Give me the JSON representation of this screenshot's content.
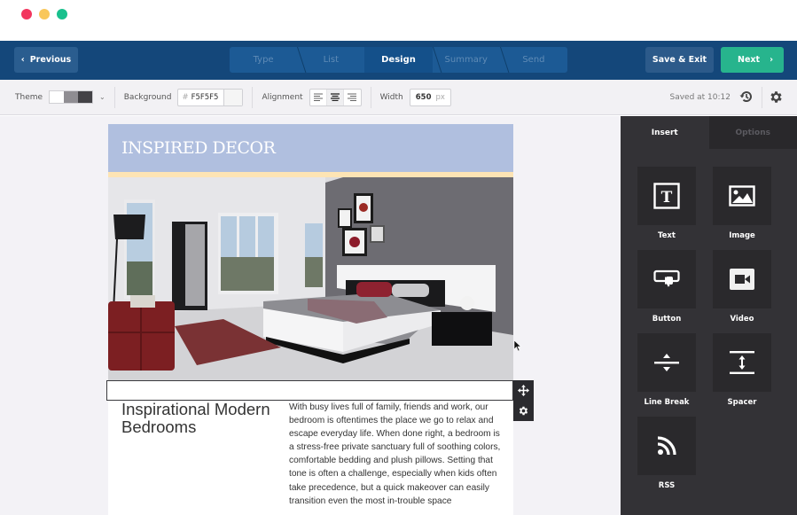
{
  "window": {
    "controls": [
      "close",
      "minimize",
      "maximize"
    ]
  },
  "topbar": {
    "previous_label": "Previous",
    "steps": [
      {
        "label": "Type",
        "active": false
      },
      {
        "label": "List",
        "active": false
      },
      {
        "label": "Design",
        "active": true
      },
      {
        "label": "Summary",
        "active": false
      },
      {
        "label": "Send",
        "active": false
      }
    ],
    "save_exit_label": "Save & Exit",
    "next_label": "Next"
  },
  "toolbar": {
    "theme_label": "Theme",
    "theme_swatches": [
      "#ffffff",
      "#8f8d92",
      "#434246"
    ],
    "background_label": "Background",
    "background_hash": "#",
    "background_value": "F5F5F5",
    "alignment_label": "Alignment",
    "alignment_options": [
      "left",
      "center",
      "right"
    ],
    "alignment_selected": "center",
    "width_label": "Width",
    "width_value": "650",
    "width_unit": "px",
    "saved_status": "Saved at 10:12"
  },
  "email": {
    "banner_title": "INSPIRED DECOR",
    "banner_color": "#b0bfdf",
    "stripe_color": "#fde4b4",
    "hero_image_alt": "Modern bedroom with white bed, grey wall, red ottoman and rug",
    "heading": "Inspirational Modern Bedrooms",
    "body": "With busy lives full of family, friends and work, our bedroom is oftentimes the place we go to relax and escape everyday life. When done right, a bedroom is a stress-free private sanctuary full of soothing colors, comfortable bedding and plush pillows. Setting that tone is often a challenge, especially when kids often take precedence, but a quick makeover can easily transition even the most in-trouble space"
  },
  "panel": {
    "tabs": [
      {
        "label": "Insert",
        "active": true
      },
      {
        "label": "Options",
        "active": false
      }
    ],
    "items": [
      {
        "label": "Text",
        "icon": "text-icon"
      },
      {
        "label": "Image",
        "icon": "image-icon"
      },
      {
        "label": "Button",
        "icon": "button-icon"
      },
      {
        "label": "Video",
        "icon": "video-icon"
      },
      {
        "label": "Line Break",
        "icon": "line-break-icon"
      },
      {
        "label": "Spacer",
        "icon": "spacer-icon"
      },
      {
        "label": "RSS",
        "icon": "rss-icon"
      }
    ]
  }
}
